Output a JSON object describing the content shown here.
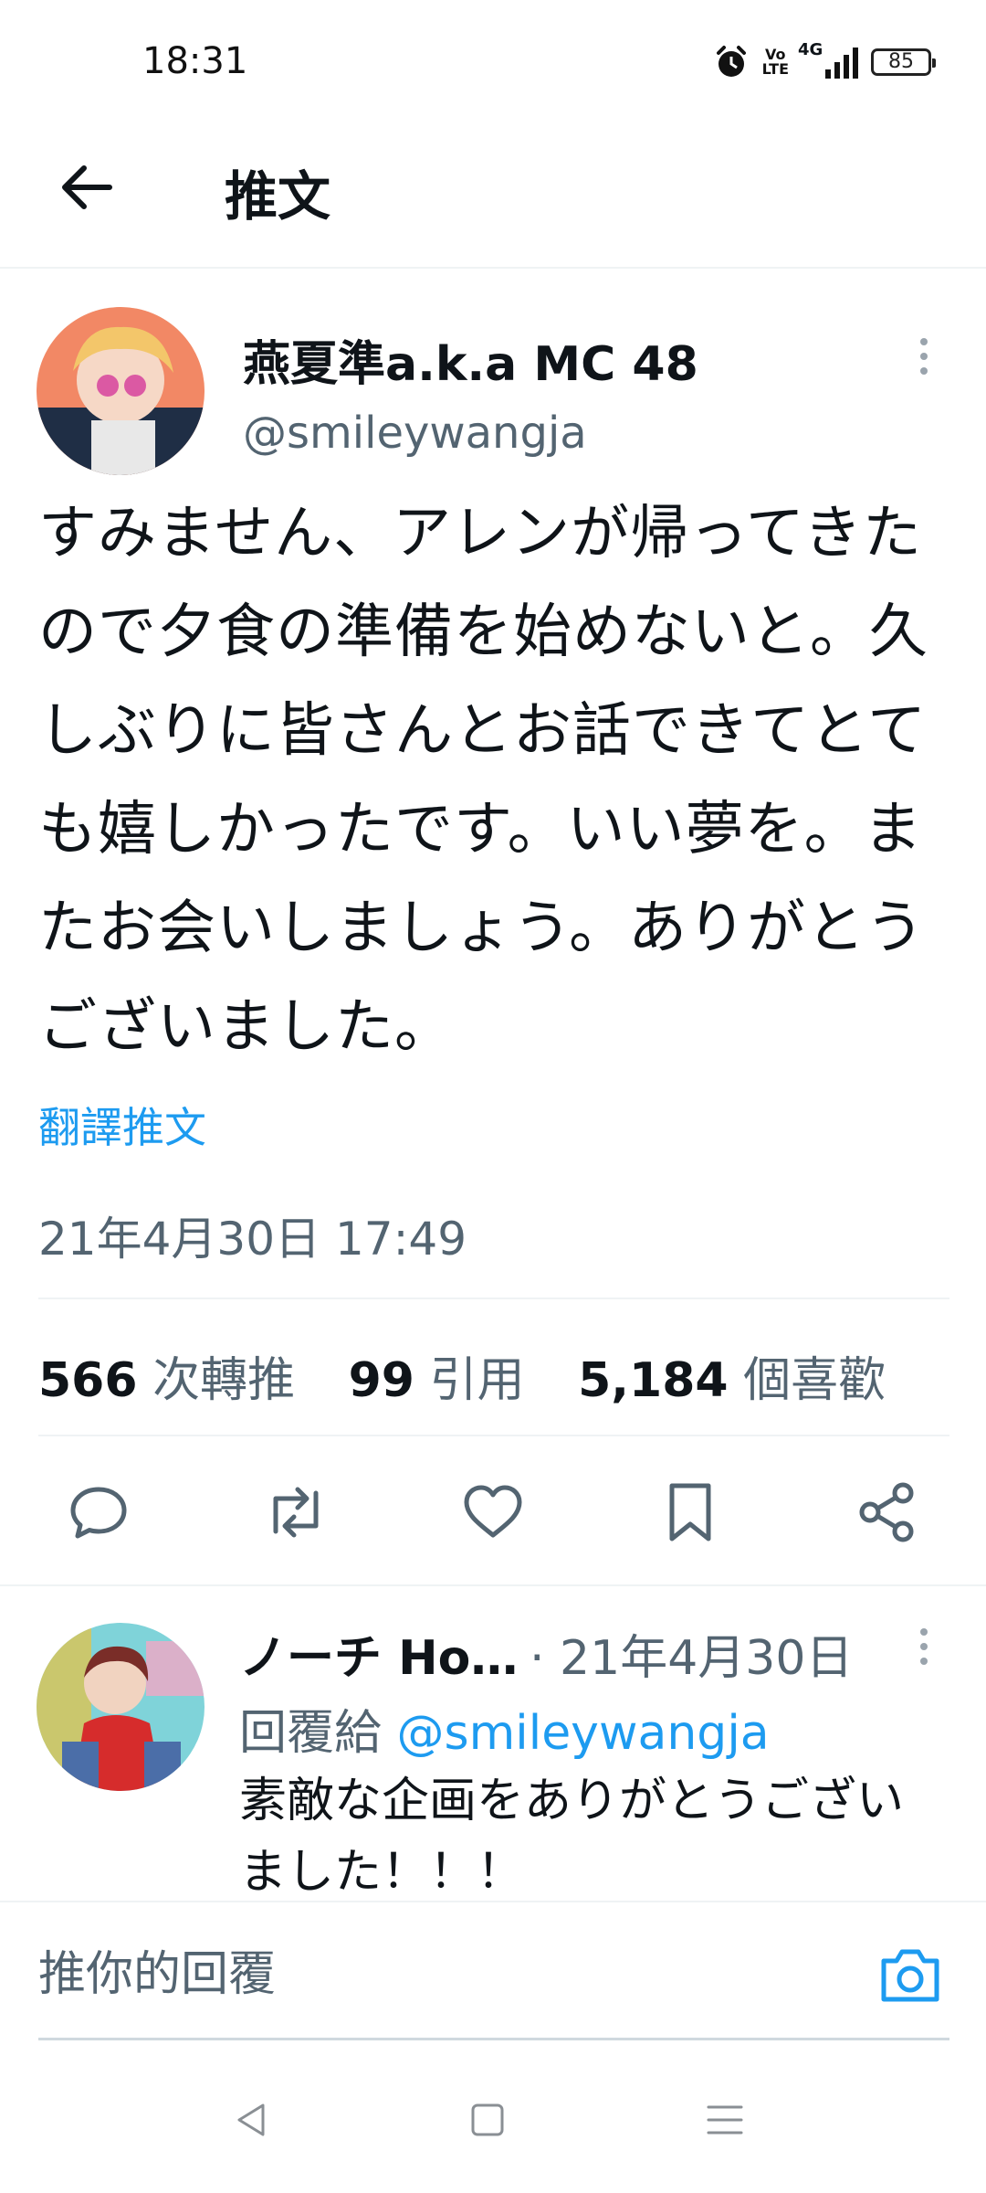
{
  "status_bar": {
    "time": "18:31",
    "network_label": "4G",
    "volte_label_top": "Vo",
    "volte_label_bottom": "LTE",
    "battery_level": "85"
  },
  "header": {
    "title": "推文"
  },
  "tweet": {
    "display_name": "燕夏準a.k.a MC 48",
    "handle": "@smileywangja",
    "text": "すみません、アレンが帰ってきたので夕食の準備を始めないと。久しぶりに皆さんとお話できてとても嬉しかったです。いい夢を。またお会いしましょう。ありがとうございました。",
    "translate_label": "翻譯推文",
    "timestamp": "21年4月30日 17:49",
    "stats": {
      "retweets_count": "566",
      "retweets_label": "次轉推",
      "quotes_count": "99",
      "quotes_label": "引用",
      "likes_count": "5,184",
      "likes_label": "個喜歡"
    },
    "actions": [
      "reply-icon",
      "retweet-icon",
      "like-icon",
      "bookmark-icon",
      "share-icon"
    ]
  },
  "reply": {
    "display_name": "ノーチ Ho…",
    "date": "· 21年4月30日",
    "reply_to_label": "回覆給",
    "reply_to_handle": "@smileywangja",
    "text": "素敵な企画をありがとうございました！！！"
  },
  "composer": {
    "placeholder": "推你的回覆"
  },
  "colors": {
    "accent": "#1d9bf0",
    "text_primary": "#0f1419",
    "text_secondary": "#536471",
    "divider": "#eff3f4"
  }
}
